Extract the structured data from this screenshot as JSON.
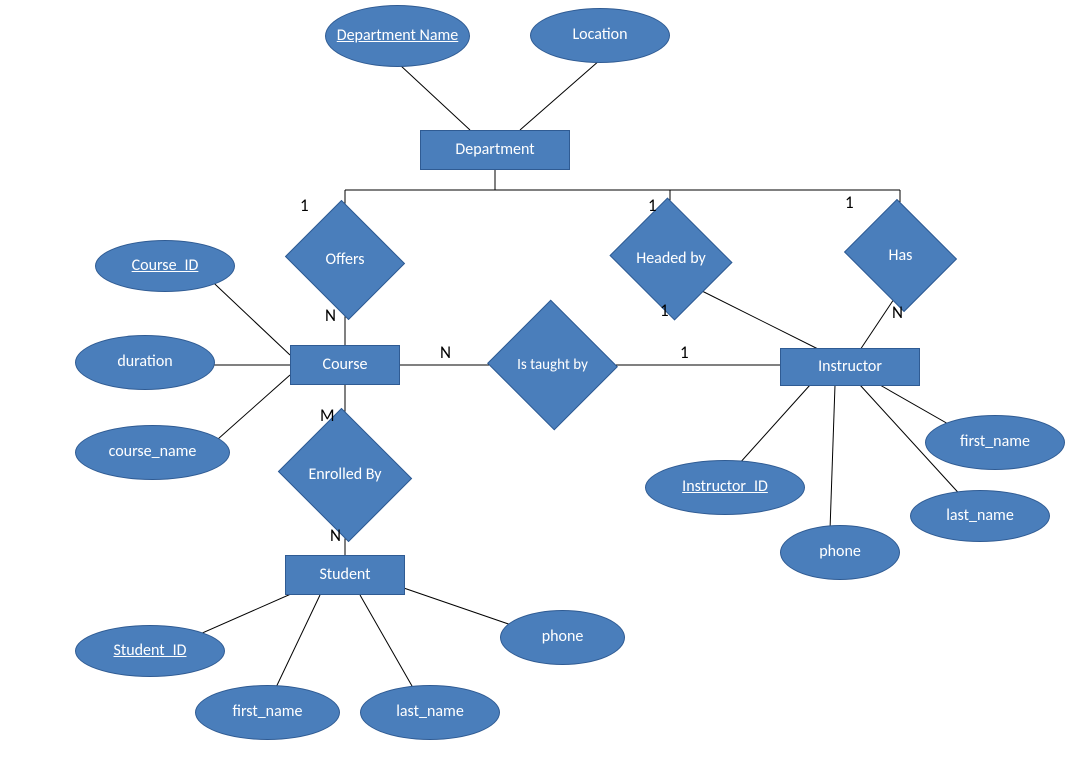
{
  "entities": {
    "department": "Department",
    "course": "Course",
    "instructor": "Instructor",
    "student": "Student"
  },
  "relationships": {
    "offers": "Offers",
    "headed_by": "Headed by",
    "has": "Has",
    "is_taught_by": "Is taught by",
    "enrolled_by": "Enrolled By"
  },
  "attributes": {
    "department_name": "Department Name",
    "location": "Location",
    "course_id": "Course_ID",
    "duration": "duration",
    "course_name": "course_name",
    "instructor_id": "Instructor_ID",
    "instructor_first_name": "first_name",
    "instructor_last_name": "last_name",
    "instructor_phone": "phone",
    "student_id": "Student_ID",
    "student_first_name": "first_name",
    "student_last_name": "last_name",
    "student_phone": "phone"
  },
  "cardinalities": {
    "dept_offers": "1",
    "offers_course": "N",
    "dept_headed": "1",
    "headed_instr": "1",
    "dept_has": "1",
    "has_instr": "N",
    "course_taught": "N",
    "taught_instr": "1",
    "course_enrolled": "M",
    "enrolled_student": "N"
  }
}
